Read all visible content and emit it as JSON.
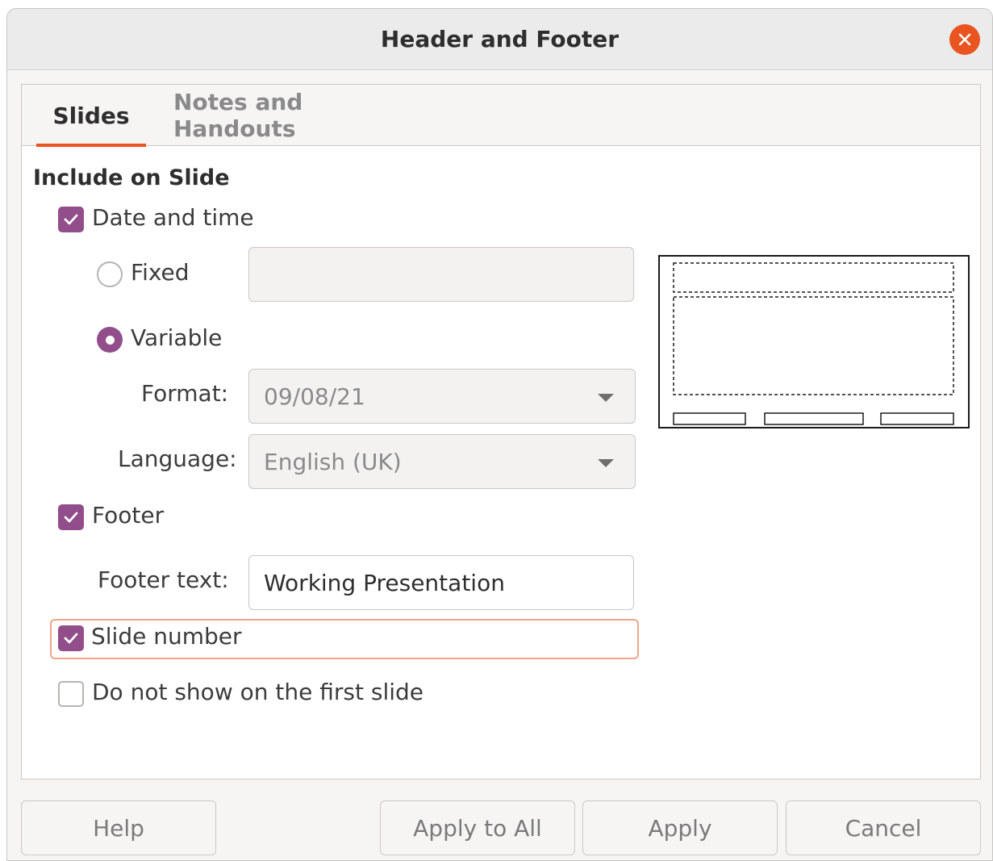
{
  "window": {
    "title": "Header and Footer"
  },
  "tabs": [
    {
      "label": "Slides",
      "active": true
    },
    {
      "label": "Notes and Handouts",
      "active": false
    }
  ],
  "section": {
    "title": "Include on Slide"
  },
  "date_time": {
    "label": "Date and time",
    "checked": true
  },
  "fixed": {
    "label": "Fixed",
    "selected": false,
    "value": ""
  },
  "variable": {
    "label": "Variable",
    "selected": true
  },
  "format": {
    "label": "Format:",
    "value": "09/08/21"
  },
  "language": {
    "label": "Language:",
    "value": "English (UK)"
  },
  "footer": {
    "label": "Footer",
    "checked": true
  },
  "footer_text": {
    "label": "Footer text:",
    "value": "Working Presentation"
  },
  "slide_number": {
    "label": "Slide number",
    "checked": true
  },
  "first_slide": {
    "label": "Do not show on the first slide",
    "checked": false
  },
  "buttons": {
    "help": "Help",
    "apply_all": "Apply to All",
    "apply": "Apply",
    "cancel": "Cancel"
  },
  "colors": {
    "accent": "#e95420",
    "check": "#924d8b"
  },
  "icons": {
    "close": "close-icon",
    "check": "checkmark-icon",
    "dropdown": "chevron-down-icon"
  }
}
